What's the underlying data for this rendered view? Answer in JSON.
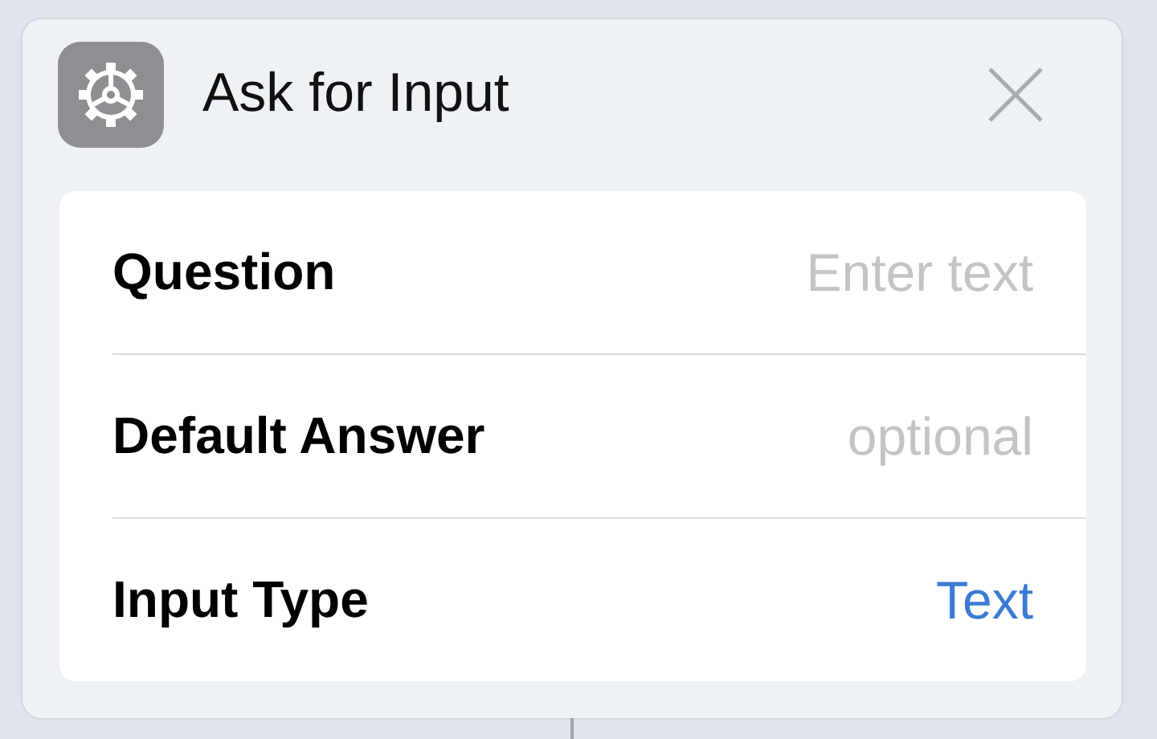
{
  "card": {
    "title": "Ask for Input"
  },
  "rows": [
    {
      "label": "Question",
      "kind": "field",
      "placeholder": "Enter text"
    },
    {
      "label": "Default Answer",
      "kind": "field",
      "placeholder": "optional"
    },
    {
      "label": "Input Type",
      "kind": "picker",
      "value": "Text"
    }
  ]
}
